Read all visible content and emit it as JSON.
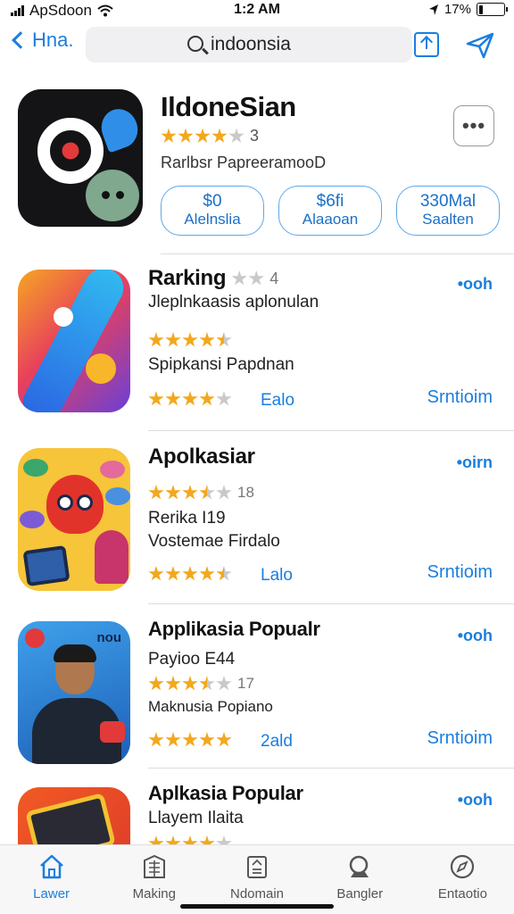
{
  "status_bar": {
    "carrier": "ApSdoon",
    "time": "1:2 AM",
    "battery_text": "17%",
    "battery_level": 0.17
  },
  "nav": {
    "back_label": "Hna.",
    "search_value": "indoonsia"
  },
  "featured": {
    "title": "IldoneSian",
    "rating_stars": 4,
    "rating_count": "3",
    "subtitle": "Rarlbsr PapreeramooD",
    "more_label": "•••",
    "prices": [
      {
        "line1": "$0",
        "line2": "Alelnslia"
      },
      {
        "line1": "$6fi",
        "line2": "Alaaoan"
      },
      {
        "line1": "330Mal",
        "line2": "Saalten"
      }
    ]
  },
  "list": [
    {
      "title": "Rarking",
      "title_count": "4",
      "action": "•ooh",
      "line1": "Jleplnkaasis aplonulan",
      "rating1_stars": 4.5,
      "rating1_count": "",
      "line2": "Spipkansi Papdnan",
      "rating2_stars": 4,
      "meta": "Ealo",
      "link": "Srntioim",
      "icon": "abstract-y-icon"
    },
    {
      "title": "Apolkasiar",
      "title_count": "",
      "action": "•oirn",
      "line1": "",
      "rating1_stars": 3.5,
      "rating1_count": "18",
      "line2": "Rerika I19",
      "line3": "Vostemae Firdalo",
      "rating2_stars": 4.5,
      "meta": "Lalo",
      "link": "Srntioim",
      "icon": "cartoon-icon"
    },
    {
      "title": "Applikasia Popualr",
      "title_count": "",
      "action": "•ooh",
      "line1": "Payioo E44",
      "rating1_stars": 3.5,
      "rating1_count": "17",
      "line2": "Maknusia Popiano",
      "rating2_stars": 5,
      "meta": "2ald",
      "link": "Srntioim",
      "icon": "person-icon"
    },
    {
      "title": "Aplkasia Popular",
      "title_count": "",
      "action": "•ooh",
      "line1": "Llayem Ilaita",
      "rating1_stars": 4,
      "rating1_count": "",
      "icon": "tablet-icon"
    }
  ],
  "tabs": [
    {
      "label": "Lawer",
      "icon": "home-icon",
      "active": true
    },
    {
      "label": "Making",
      "icon": "building-icon",
      "active": false
    },
    {
      "label": "Ndomain",
      "icon": "document-icon",
      "active": false
    },
    {
      "label": "Bangler",
      "icon": "search-bag-icon",
      "active": false
    },
    {
      "label": "Entaotio",
      "icon": "compass-icon",
      "active": false
    }
  ],
  "colors": {
    "accent": "#1a7ee0",
    "star": "#f2a81d"
  }
}
